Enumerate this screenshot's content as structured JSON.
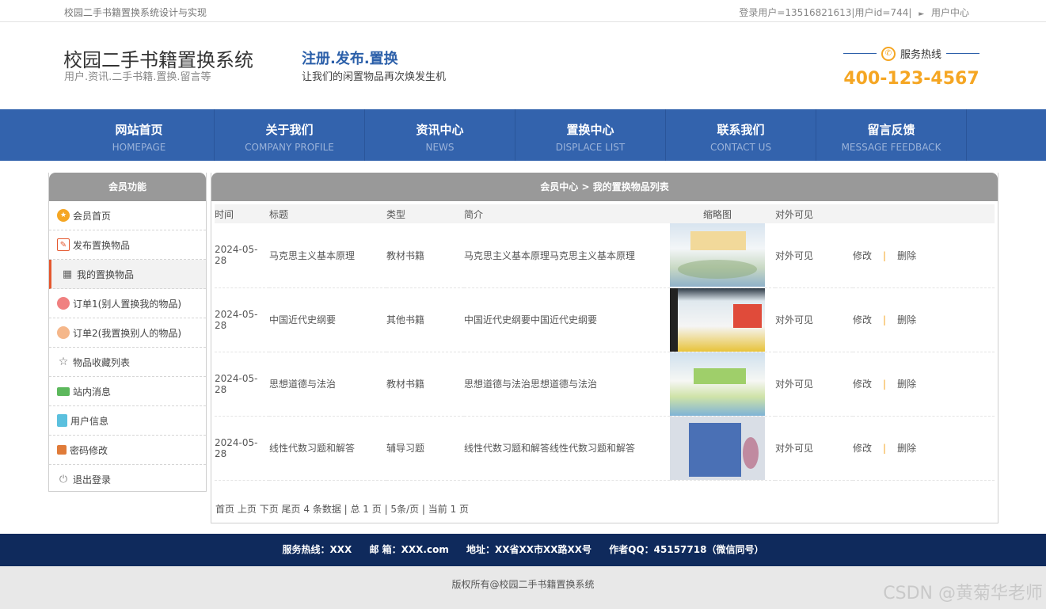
{
  "topbar": {
    "site": "校园二手书籍置换系统设计与实现",
    "user_info": "登录用户=13516821613|用户id=744|",
    "user_center": "用户中心"
  },
  "header": {
    "title": "校园二手书籍置换系统",
    "subtitle": "用户.资讯.二手书籍.置换.留言等",
    "slogan_title": "注册.发布.置换",
    "slogan_sub": "让我们的闲置物品再次焕发生机",
    "hotline_label": "服务热线",
    "hotline_number": "400-123-4567"
  },
  "nav": [
    {
      "cn": "网站首页",
      "en": "HOMEPAGE"
    },
    {
      "cn": "关于我们",
      "en": "COMPANY PROFILE"
    },
    {
      "cn": "资讯中心",
      "en": "NEWS"
    },
    {
      "cn": "置换中心",
      "en": "DISPLACE LIST"
    },
    {
      "cn": "联系我们",
      "en": "CONTACT US"
    },
    {
      "cn": "留言反馈",
      "en": "MESSAGE FEEDBACK"
    }
  ],
  "sidebar": {
    "title": "会员功能",
    "items": [
      {
        "label": "会员首页",
        "icon": "member-home-icon",
        "color": "#f5a623"
      },
      {
        "label": "发布置换物品",
        "icon": "edit-icon",
        "color": "#e4572e"
      },
      {
        "label": "我的置换物品",
        "icon": "grid-icon",
        "color": "#666666"
      },
      {
        "label": "订单1(别人置换我的物品)",
        "icon": "order-icon",
        "color": "#f08080"
      },
      {
        "label": "订单2(我置换别人的物品)",
        "icon": "order-icon",
        "color": "#f5b78a"
      },
      {
        "label": "物品收藏列表",
        "icon": "star-icon",
        "color": "#666666"
      },
      {
        "label": "站内消息",
        "icon": "message-icon",
        "color": "#5cb85c"
      },
      {
        "label": "用户信息",
        "icon": "user-info-icon",
        "color": "#5bc0de"
      },
      {
        "label": "密码修改",
        "icon": "lock-icon",
        "color": "#e07b39"
      },
      {
        "label": "退出登录",
        "icon": "power-icon",
        "color": "#888888"
      }
    ]
  },
  "content": {
    "title": "会员中心 > 我的置换物品列表",
    "columns": [
      "时间",
      "标题",
      "类型",
      "简介",
      "缩略图",
      "对外可见"
    ],
    "rows": [
      {
        "time": "2024-05-28",
        "title": "马克思主义基本原理",
        "type": "教材书籍",
        "intro": "马克思主义基本原理马克思主义基本原理",
        "visible": "对外可见",
        "edit": "修改",
        "sep": "|",
        "delete": "删除"
      },
      {
        "time": "2024-05-28",
        "title": "中国近代史纲要",
        "type": "其他书籍",
        "intro": "中国近代史纲要中国近代史纲要",
        "visible": "对外可见",
        "edit": "修改",
        "sep": "|",
        "delete": "删除"
      },
      {
        "time": "2024-05-28",
        "title": "思想道德与法治",
        "type": "教材书籍",
        "intro": "思想道德与法治思想道德与法治",
        "visible": "对外可见",
        "edit": "修改",
        "sep": "|",
        "delete": "删除"
      },
      {
        "time": "2024-05-28",
        "title": "线性代数习题和解答",
        "type": "辅导习题",
        "intro": "线性代数习题和解答线性代数习题和解答",
        "visible": "对外可见",
        "edit": "修改",
        "sep": "|",
        "delete": "删除"
      }
    ],
    "pager": {
      "first": "首页",
      "prev": "上页",
      "next": "下页",
      "last": "尾页",
      "info": "4 条数据 | 总 1 页 | 5条/页 | 当前 1 页"
    }
  },
  "footer": {
    "hotline": "服务热线：XXX",
    "email": "邮 箱：XXX.com",
    "address": "地址：XX省XX市XX路XX号",
    "qq": "作者QQ：45157718（微信同号）",
    "copyright": "版权所有@校园二手书籍置换系统",
    "watermark": "CSDN @黄菊华老师"
  }
}
